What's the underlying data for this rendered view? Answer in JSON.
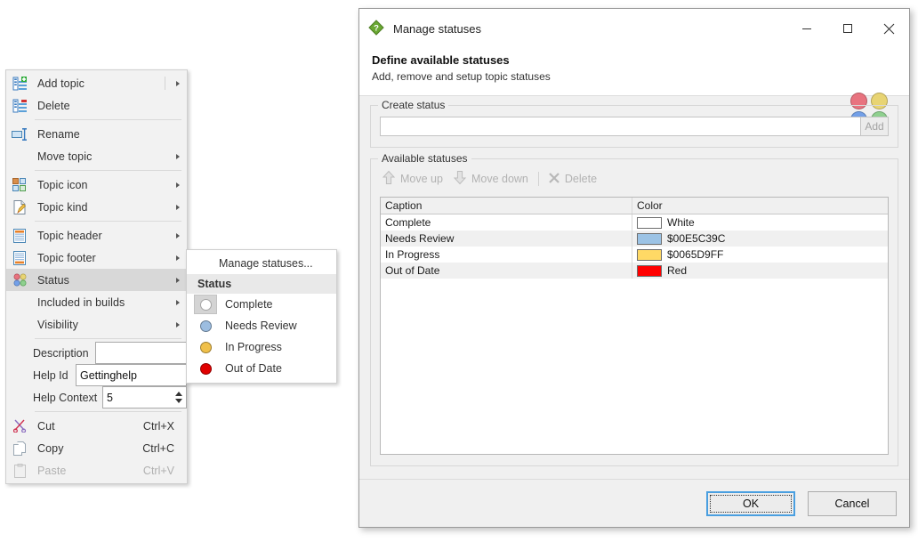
{
  "context_menu": {
    "items": [
      {
        "label": "Add topic",
        "icon": "add-topic-icon",
        "submenu": true,
        "separator_before_arrow": true,
        "shortcut": "",
        "disabled": false
      },
      {
        "label": "Delete",
        "icon": "delete-topic-icon",
        "submenu": false,
        "shortcut": "",
        "disabled": false
      },
      {
        "label": "Rename",
        "icon": "rename-icon",
        "submenu": false,
        "shortcut": "",
        "disabled": false
      },
      {
        "label": "Move topic",
        "icon": "",
        "submenu": true,
        "shortcut": "",
        "disabled": false
      },
      {
        "label": "Topic icon",
        "icon": "topic-icon-icon",
        "submenu": true,
        "shortcut": "",
        "disabled": false
      },
      {
        "label": "Topic kind",
        "icon": "topic-kind-icon",
        "submenu": true,
        "shortcut": "",
        "disabled": false
      },
      {
        "label": "Topic header",
        "icon": "topic-header-icon",
        "submenu": true,
        "shortcut": "",
        "disabled": false
      },
      {
        "label": "Topic footer",
        "icon": "topic-footer-icon",
        "submenu": true,
        "shortcut": "",
        "disabled": false
      },
      {
        "label": "Status",
        "icon": "status-icon",
        "submenu": true,
        "shortcut": "",
        "disabled": false,
        "selected": true
      },
      {
        "label": "Included in builds",
        "icon": "",
        "submenu": true,
        "shortcut": "",
        "disabled": false
      },
      {
        "label": "Visibility",
        "icon": "",
        "submenu": true,
        "shortcut": "",
        "disabled": false
      }
    ],
    "fields": {
      "description_label": "Description",
      "description_value": "",
      "help_id_label": "Help Id",
      "help_id_value": "Gettinghelp",
      "help_context_label": "Help Context",
      "help_context_value": "5"
    },
    "clipboard": [
      {
        "label": "Cut",
        "shortcut": "Ctrl+X",
        "icon": "scissors-icon",
        "disabled": false
      },
      {
        "label": "Copy",
        "shortcut": "Ctrl+C",
        "icon": "copy-icon",
        "disabled": false
      },
      {
        "label": "Paste",
        "shortcut": "Ctrl+V",
        "icon": "clipboard-icon",
        "disabled": true
      }
    ]
  },
  "submenu": {
    "manage_label": "Manage statuses...",
    "header": "Status",
    "statuses": [
      {
        "label": "Complete",
        "color": "#ffffff",
        "selected": true
      },
      {
        "label": "Needs Review",
        "color": "#9cbde0",
        "selected": false
      },
      {
        "label": "In Progress",
        "color": "#f0c04a",
        "selected": false
      },
      {
        "label": "Out of Date",
        "color": "#e00000",
        "selected": false
      }
    ]
  },
  "dialog": {
    "title": "Manage statuses",
    "title_icon": "help-diamond-icon",
    "window_buttons": {
      "minimize": "minimize-icon",
      "maximize": "maximize-icon",
      "close": "close-icon"
    },
    "banner": {
      "heading": "Define available statuses",
      "subheading": "Add, remove and setup topic statuses",
      "deco_colors": [
        "#e8737f",
        "#e8d473",
        "#73a0e8",
        "#8fd08f"
      ]
    },
    "create_group": {
      "title": "Create status",
      "input_value": "",
      "input_placeholder": "",
      "add_button": "Add"
    },
    "available_group": {
      "title": "Available statuses",
      "toolbar": [
        {
          "label": "Move up",
          "icon": "arrow-up-icon",
          "disabled": true
        },
        {
          "label": "Move down",
          "icon": "arrow-down-icon",
          "disabled": true
        },
        {
          "label": "Delete",
          "icon": "x-mark-icon",
          "disabled": true
        }
      ],
      "columns": [
        "Caption",
        "Color"
      ],
      "rows": [
        {
          "caption": "Complete",
          "color_name": "White",
          "color_hex": "#ffffff"
        },
        {
          "caption": "Needs Review",
          "color_name": "$00E5C39C",
          "color_hex": "#9cc3e5"
        },
        {
          "caption": "In Progress",
          "color_name": "$0065D9FF",
          "color_hex": "#ffd965"
        },
        {
          "caption": "Out of Date",
          "color_name": "Red",
          "color_hex": "#ff0000"
        }
      ]
    },
    "buttons": {
      "ok": "OK",
      "cancel": "Cancel"
    }
  }
}
